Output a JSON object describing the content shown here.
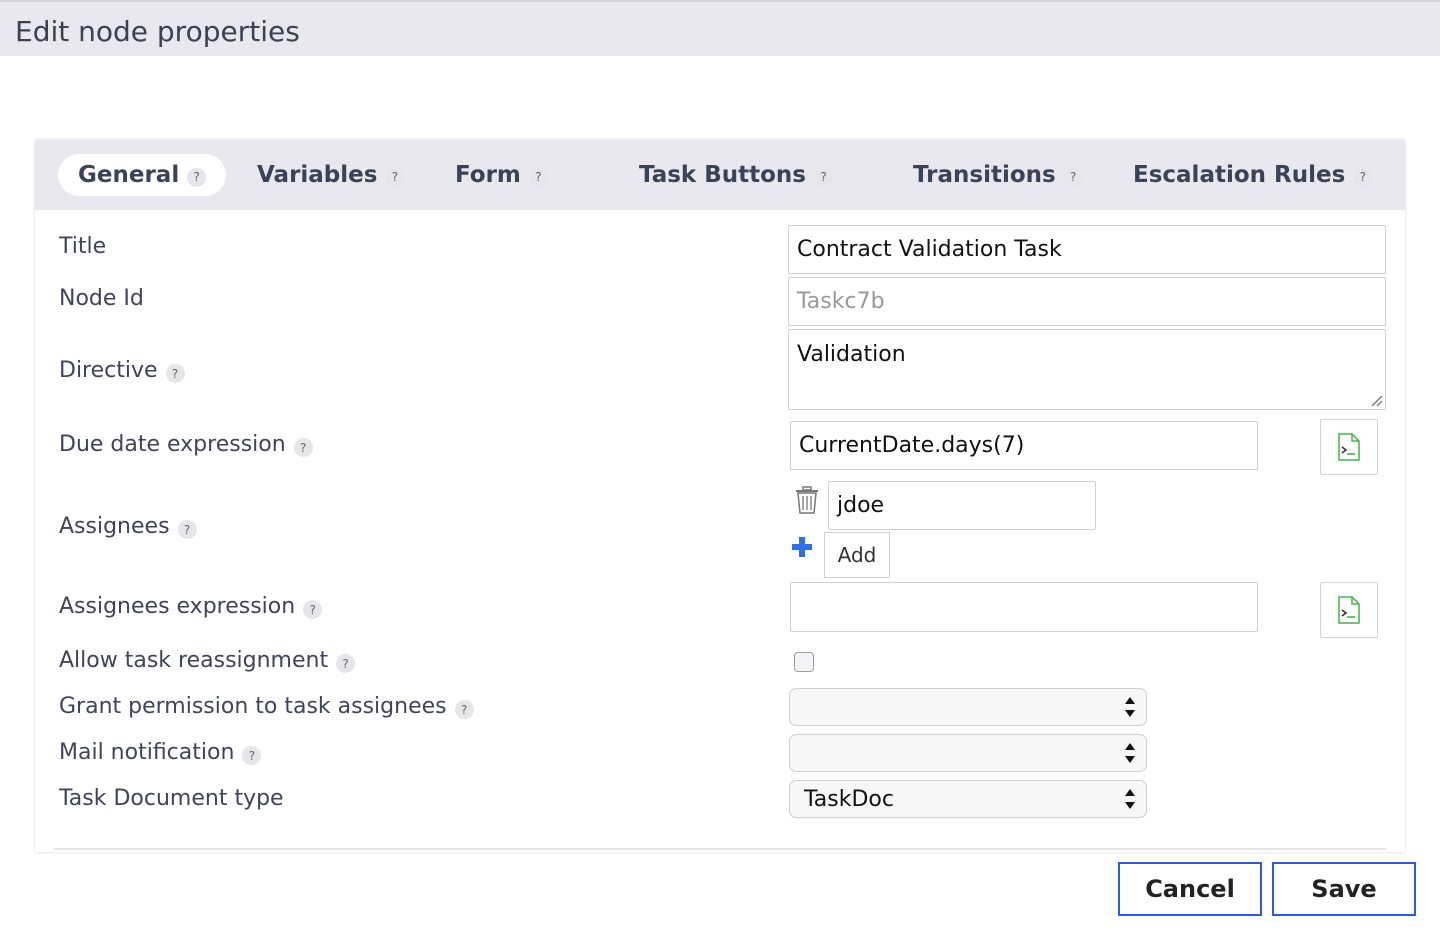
{
  "header": {
    "title": "Edit node properties"
  },
  "tabs": [
    {
      "label": "General",
      "help": "?"
    },
    {
      "label": "Variables",
      "help": "?"
    },
    {
      "label": "Form",
      "help": "?"
    },
    {
      "label": "Task Buttons",
      "help": "?"
    },
    {
      "label": "Transitions",
      "help": "?"
    },
    {
      "label": "Escalation Rules",
      "help": "?"
    }
  ],
  "form": {
    "title": {
      "label": "Title",
      "value": "Contract Validation Task"
    },
    "node_id": {
      "label": "Node Id",
      "placeholder": "Taskc7b"
    },
    "directive": {
      "label": "Directive",
      "help": "?",
      "value": "Validation"
    },
    "due_date": {
      "label": "Due date expression",
      "help": "?",
      "value": "CurrentDate.days(7)"
    },
    "assignees": {
      "label": "Assignees",
      "help": "?",
      "items": [
        "jdoe"
      ],
      "add_label": "Add"
    },
    "assignees_expression": {
      "label": "Assignees expression",
      "help": "?",
      "value": ""
    },
    "allow_reassignment": {
      "label": "Allow task reassignment",
      "help": "?",
      "checked": false
    },
    "grant_permission": {
      "label": "Grant permission to task assignees",
      "help": "?",
      "value": ""
    },
    "mail_notification": {
      "label": "Mail notification",
      "help": "?",
      "value": ""
    },
    "doc_type": {
      "label": "Task Document type",
      "value": "TaskDoc"
    }
  },
  "footer": {
    "cancel_label": "Cancel",
    "save_label": "Save"
  },
  "colors": {
    "accent": "#2b5bd7",
    "header_bg": "#e8e8ee",
    "plus": "#2f6fe0",
    "script_green": "#4caf50"
  }
}
